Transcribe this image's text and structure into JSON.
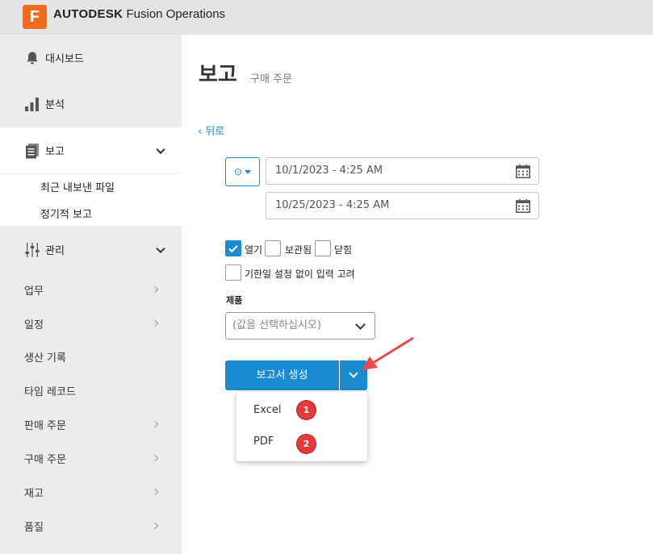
{
  "header": {
    "logo_letter": "F",
    "brand_bold": "AUTODESK",
    "brand_product": " Fusion Operations"
  },
  "sidebar": {
    "dashboard": "대시보드",
    "analysis": "분석",
    "reports": "보고",
    "report_sub": [
      "최근 내보낸 파일",
      "정기적 보고"
    ],
    "manage": "관리",
    "items": [
      "업무",
      "일정",
      "생산 기록",
      "타임 레코드",
      "판매 주문",
      "구매 주문",
      "재고",
      "품질"
    ]
  },
  "main": {
    "title": "보고",
    "subtitle": "구매 주문",
    "back": "‹ 뒤로",
    "date_from": "10/1/2023 - 4:25 AM",
    "date_to": "10/25/2023 - 4:25 AM",
    "clock_symbol": "⊙",
    "status_filters": [
      {
        "label": "열기",
        "checked": true
      },
      {
        "label": "보관됨",
        "checked": false
      },
      {
        "label": "닫힘",
        "checked": false
      }
    ],
    "no_deadline_label": "기한일 설정 없이 입력 고려",
    "product_label": "제품",
    "product_placeholder": "(값을 선택하십시오)",
    "generate_label": "보고서 생성",
    "export_options": [
      "Excel",
      "PDF"
    ],
    "badges": [
      "1",
      "2"
    ]
  },
  "colors": {
    "accent": "#1c8ad0",
    "logo": "#f26b1d",
    "badge": "#e53a3a",
    "arrow": "#e84a4a"
  }
}
